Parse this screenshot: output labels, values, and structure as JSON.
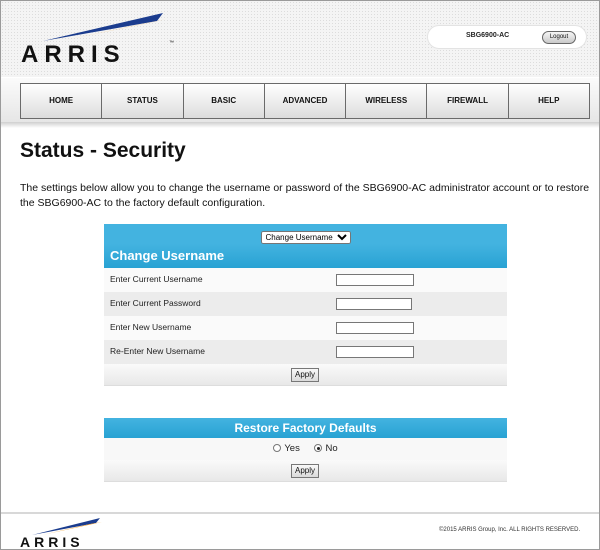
{
  "brand": {
    "name": "ARRIS",
    "trademark": "™",
    "colors": {
      "blue": "#1b3c8e",
      "orange": "#f39a1e",
      "accent": "#43b3e0"
    }
  },
  "header": {
    "model": "SBG6900-AC",
    "logout_label": "Logout"
  },
  "nav": {
    "items": [
      "HOME",
      "STATUS",
      "BASIC",
      "ADVANCED",
      "WIRELESS",
      "FIREWALL",
      "HELP"
    ]
  },
  "page": {
    "title": "Status - Security",
    "intro": "The settings below allow you to change the username or password of the SBG6900-AC administrator account or to restore the SBG6900-AC to the factory default configuration."
  },
  "change_username": {
    "select": {
      "selected": "Change Username",
      "options": [
        "Change Username"
      ]
    },
    "heading": "Change Username",
    "fields": [
      {
        "label": "Enter Current Username",
        "value": ""
      },
      {
        "label": "Enter Current Password",
        "value": ""
      },
      {
        "label": "Enter New Username",
        "value": ""
      },
      {
        "label": "Re-Enter New Username",
        "value": ""
      }
    ],
    "apply_label": "Apply"
  },
  "restore": {
    "heading": "Restore Factory Defaults",
    "options": [
      {
        "label": "Yes",
        "checked": false
      },
      {
        "label": "No",
        "checked": true
      }
    ],
    "apply_label": "Apply"
  },
  "footer": {
    "copyright": "©2015 ARRIS Group, Inc. ALL RIGHTS RESERVED."
  }
}
